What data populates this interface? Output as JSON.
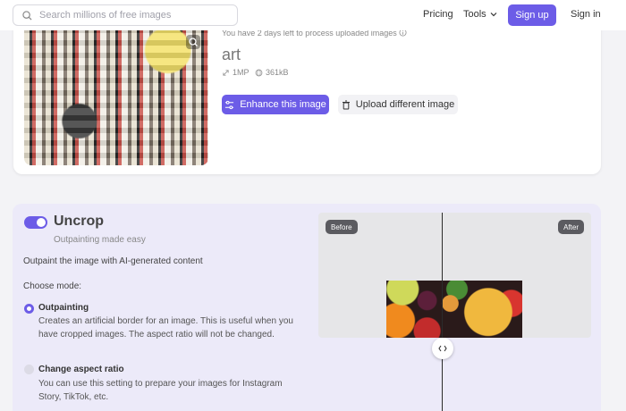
{
  "header": {
    "search_placeholder": "Search millions of free images",
    "pricing": "Pricing",
    "tools": "Tools",
    "signup": "Sign up",
    "signin": "Sign in"
  },
  "upload": {
    "notice": "You have 2 days left to process uploaded images",
    "title": "art",
    "resolution": "1MP",
    "size": "361kB",
    "enhance_button": "Enhance this image",
    "upload_button": "Upload different image"
  },
  "uncrop": {
    "title": "Uncrop",
    "subtitle": "Outpainting made easy",
    "description": "Outpaint the image with AI-generated content",
    "choose_mode": "Choose mode:",
    "toggle_on": true,
    "options": [
      {
        "title": "Outpainting",
        "description": "Creates an artificial border for an image. This is useful when you have cropped images. The aspect ratio will not be changed.",
        "selected": true
      },
      {
        "title": "Change aspect ratio",
        "description": "You can use this setting to prepare your images for Instagram Story, TikTok, etc.",
        "selected": false
      }
    ],
    "viewer": {
      "before_label": "Before",
      "after_label": "After"
    }
  },
  "colors": {
    "accent": "#6c5ce7",
    "panel_bg": "#eceaf9",
    "page_bg": "#f3f3f6"
  }
}
